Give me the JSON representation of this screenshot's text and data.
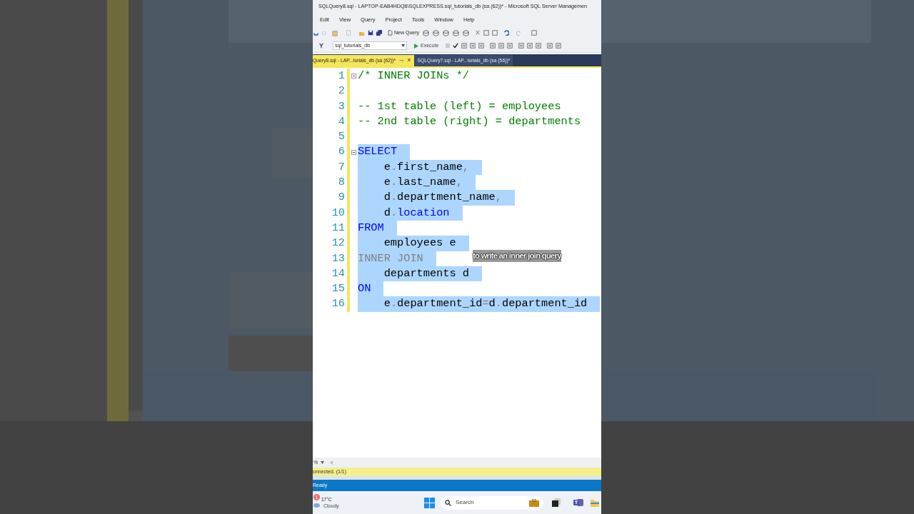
{
  "window": {
    "title": "SQLQuery8.sql - LAPTOP-EAB4HDQ6\\SQLEXPRESS.sql_tutorials_db (sa (62))* - Microsoft SQL Server Managemen"
  },
  "menu": [
    "Edit",
    "View",
    "Query",
    "Project",
    "Tools",
    "Window",
    "Help"
  ],
  "toolbar": {
    "new_query": "New Query",
    "database": "sql_tutorials_db",
    "execute": "Execute"
  },
  "tabs": [
    {
      "label": "Query8.sql - LAP...torials_db (sa (62))*",
      "selected": true,
      "pin": "⊸",
      "close": "×"
    },
    {
      "label": "SQLQuery7.sql - LAP...torials_db (sa (56))*",
      "selected": false
    }
  ],
  "lines": [
    {
      "number": "1",
      "collapse": true,
      "indent": false,
      "selected": false,
      "tokens": [
        {
          "kind": "comment",
          "text": "/* INNER JOINs */"
        }
      ]
    },
    {
      "number": "2",
      "collapse": false,
      "selected": false
    },
    {
      "number": "3",
      "collapse": false,
      "indent": false,
      "selected": false,
      "tokens": [
        {
          "kind": "comment",
          "text": "-- 1st table (left) = employees"
        }
      ]
    },
    {
      "number": "4",
      "collapse": false,
      "indent": false,
      "selected": false,
      "tokens": [
        {
          "kind": "comment",
          "text": "-- 2nd table (right) = departments"
        }
      ]
    },
    {
      "number": "5",
      "collapse": false,
      "selected": false
    },
    {
      "number": "6",
      "collapse": true,
      "indent": false,
      "selected": true,
      "tokens": [
        {
          "kind": "keyword",
          "text": "SELECT"
        }
      ]
    },
    {
      "number": "7",
      "collapse": false,
      "indent": true,
      "selected": true,
      "tokens": [
        {
          "kind": "plain",
          "text": "e"
        },
        {
          "kind": "operator",
          "text": "."
        },
        {
          "kind": "plain",
          "text": "first_name"
        },
        {
          "kind": "operator",
          "text": ","
        }
      ]
    },
    {
      "number": "8",
      "collapse": false,
      "indent": true,
      "selected": true,
      "tokens": [
        {
          "kind": "plain",
          "text": "e"
        },
        {
          "kind": "operator",
          "text": "."
        },
        {
          "kind": "plain",
          "text": "last_name"
        },
        {
          "kind": "operator",
          "text": ","
        }
      ]
    },
    {
      "number": "9",
      "collapse": false,
      "indent": true,
      "selected": true,
      "tokens": [
        {
          "kind": "plain",
          "text": "d"
        },
        {
          "kind": "operator",
          "text": "."
        },
        {
          "kind": "plain",
          "text": "department_name"
        },
        {
          "kind": "operator",
          "text": ","
        }
      ]
    },
    {
      "number": "10",
      "collapse": false,
      "indent": true,
      "selected": true,
      "tokens": [
        {
          "kind": "plain",
          "text": "d"
        },
        {
          "kind": "operator",
          "text": "."
        },
        {
          "kind": "keyword",
          "text": "location"
        }
      ]
    },
    {
      "number": "11",
      "collapse": false,
      "indent": false,
      "selected": true,
      "tokens": [
        {
          "kind": "keyword",
          "text": "FROM"
        }
      ]
    },
    {
      "number": "12",
      "collapse": false,
      "indent": true,
      "selected": true,
      "tokens": [
        {
          "kind": "plain",
          "text": "employees e"
        }
      ]
    },
    {
      "number": "13",
      "collapse": false,
      "indent": false,
      "selected": true,
      "tokens": [
        {
          "kind": "operator",
          "text": "INNER JOIN"
        }
      ]
    },
    {
      "number": "14",
      "collapse": false,
      "indent": true,
      "selected": true,
      "tokens": [
        {
          "kind": "plain",
          "text": "departments d"
        }
      ]
    },
    {
      "number": "15",
      "collapse": false,
      "indent": false,
      "selected": true,
      "tokens": [
        {
          "kind": "keyword",
          "text": "ON"
        }
      ]
    },
    {
      "number": "16",
      "collapse": false,
      "indent": true,
      "selected": true,
      "tokens": [
        {
          "kind": "plain",
          "text": "e"
        },
        {
          "kind": "operator",
          "text": "."
        },
        {
          "kind": "plain",
          "text": "department_id"
        },
        {
          "kind": "operator",
          "text": "="
        },
        {
          "kind": "plain",
          "text": "d"
        },
        {
          "kind": "operator",
          "text": "."
        },
        {
          "kind": "plain",
          "text": "department_id"
        }
      ]
    }
  ],
  "caption": "to write an inner join query",
  "zoom": "%",
  "connection_status": "onnected. (1/1)",
  "status_bar": "Ready",
  "taskbar": {
    "weather_badge": "1",
    "temperature": "17°C",
    "weather": "Cloudy",
    "search": "Search"
  }
}
